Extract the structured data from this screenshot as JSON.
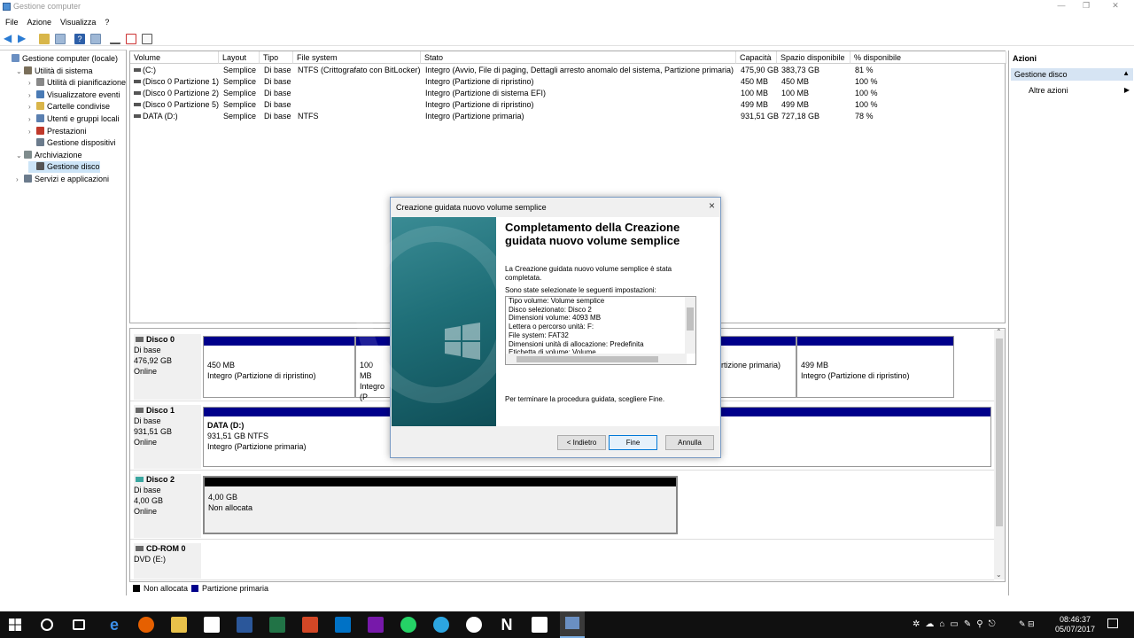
{
  "window": {
    "title": "Gestione computer",
    "controls": [
      "—",
      "❐",
      "✕"
    ]
  },
  "menu": [
    "File",
    "Azione",
    "Visualizza",
    "?"
  ],
  "tree": [
    {
      "label": "Gestione computer (locale)",
      "depth": 0,
      "expander": "",
      "icon": "computer-icon",
      "color": "#6a8fc2"
    },
    {
      "label": "Utilità di sistema",
      "depth": 1,
      "expander": "⌄",
      "icon": "tools-icon",
      "color": "#7a6f5a"
    },
    {
      "label": "Utilità di pianificazione",
      "depth": 2,
      "expander": "›",
      "icon": "clock-icon",
      "color": "#888"
    },
    {
      "label": "Visualizzatore eventi",
      "depth": 2,
      "expander": "›",
      "icon": "event-viewer-icon",
      "color": "#4a7bb5"
    },
    {
      "label": "Cartelle condivise",
      "depth": 2,
      "expander": "›",
      "icon": "shared-folder-icon",
      "color": "#d9b54a"
    },
    {
      "label": "Utenti e gruppi locali",
      "depth": 2,
      "expander": "›",
      "icon": "users-icon",
      "color": "#5a7fb0"
    },
    {
      "label": "Prestazioni",
      "depth": 2,
      "expander": "›",
      "icon": "performance-icon",
      "color": "#c0392b"
    },
    {
      "label": "Gestione dispositivi",
      "depth": 2,
      "expander": "",
      "icon": "device-manager-icon",
      "color": "#6b7b8c"
    },
    {
      "label": "Archiviazione",
      "depth": 1,
      "expander": "⌄",
      "icon": "storage-icon",
      "color": "#7f8c8d"
    },
    {
      "label": "Gestione disco",
      "depth": 2,
      "expander": "",
      "icon": "disk-management-icon",
      "color": "#555",
      "selected": true
    },
    {
      "label": "Servizi e applicazioni",
      "depth": 1,
      "expander": "›",
      "icon": "services-icon",
      "color": "#6b7b8c"
    }
  ],
  "volumes": {
    "headers": [
      "Volume",
      "Layout",
      "Tipo",
      "File system",
      "Stato",
      "Capacità",
      "Spazio disponibile",
      "% disponibile"
    ],
    "rows": [
      [
        "(C:)",
        "Semplice",
        "Di base",
        "NTFS (Crittografato con BitLocker)",
        "Integro (Avvio, File di paging, Dettagli arresto anomalo del sistema, Partizione primaria)",
        "475,90 GB",
        "383,73 GB",
        "81 %"
      ],
      [
        "(Disco 0 Partizione 1)",
        "Semplice",
        "Di base",
        "",
        "Integro (Partizione di ripristino)",
        "450 MB",
        "450 MB",
        "100 %"
      ],
      [
        "(Disco 0 Partizione 2)",
        "Semplice",
        "Di base",
        "",
        "Integro (Partizione di sistema EFI)",
        "100 MB",
        "100 MB",
        "100 %"
      ],
      [
        "(Disco 0 Partizione 5)",
        "Semplice",
        "Di base",
        "",
        "Integro (Partizione di ripristino)",
        "499 MB",
        "499 MB",
        "100 %"
      ],
      [
        "DATA (D:)",
        "Semplice",
        "Di base",
        "NTFS",
        "Integro (Partizione primaria)",
        "931,51 GB",
        "727,18 GB",
        "78 %"
      ]
    ]
  },
  "disks": [
    {
      "name": "Disco 0",
      "type": "Di base",
      "size": "476,92 GB",
      "status": "Online",
      "partitions": [
        {
          "l1": "450 MB",
          "l2": "Integro (Partizione di ripristino)"
        },
        {
          "l1": "100 MB",
          "l2": "Integro (P"
        },
        {
          "l1": "",
          "l2": "rtizione primaria)"
        },
        {
          "l1": "499 MB",
          "l2": "Integro (Partizione di ripristino)"
        }
      ]
    },
    {
      "name": "Disco 1",
      "type": "Di base",
      "size": "931,51 GB",
      "status": "Online",
      "partitions": [
        {
          "l0": "DATA  (D:)",
          "l1": "931,51 GB NTFS",
          "l2": "Integro (Partizione primaria)"
        }
      ]
    },
    {
      "name": "Disco 2",
      "type": "Di base",
      "size": "4,00 GB",
      "status": "Online",
      "partitions": [
        {
          "l1": "4,00 GB",
          "l2": "Non allocata"
        }
      ]
    },
    {
      "name": "CD-ROM 0",
      "type": "DVD (E:)",
      "size": "",
      "status": ""
    }
  ],
  "legend": [
    {
      "label": "Non allocata",
      "color": "#000000"
    },
    {
      "label": "Partizione primaria",
      "color": "#00008b"
    }
  ],
  "actions": {
    "title": "Azioni",
    "section": "Gestione disco",
    "more": "Altre azioni"
  },
  "dialog": {
    "title": "Creazione guidata nuovo volume semplice",
    "heading": "Completamento della Creazione guidata nuovo volume semplice",
    "p1": "La Creazione guidata nuovo volume semplice è stata completata.",
    "p2": "Sono state selezionate le seguenti impostazioni:",
    "settings": [
      "Tipo volume: Volume semplice",
      "Disco selezionato: Disco 2",
      "Dimensioni volume: 4093 MB",
      "Lettera o percorso unità: F:",
      "File system: FAT32",
      "Dimensioni unità di allocazione: Predefinita",
      "Etichetta di volume: Volume"
    ],
    "p3": "Per terminare la procedura guidata, scegliere Fine.",
    "back": "< Indietro",
    "finish": "Fine",
    "cancel": "Annulla"
  },
  "clock": {
    "time": "08:46:37",
    "date": "05/07/2017"
  }
}
